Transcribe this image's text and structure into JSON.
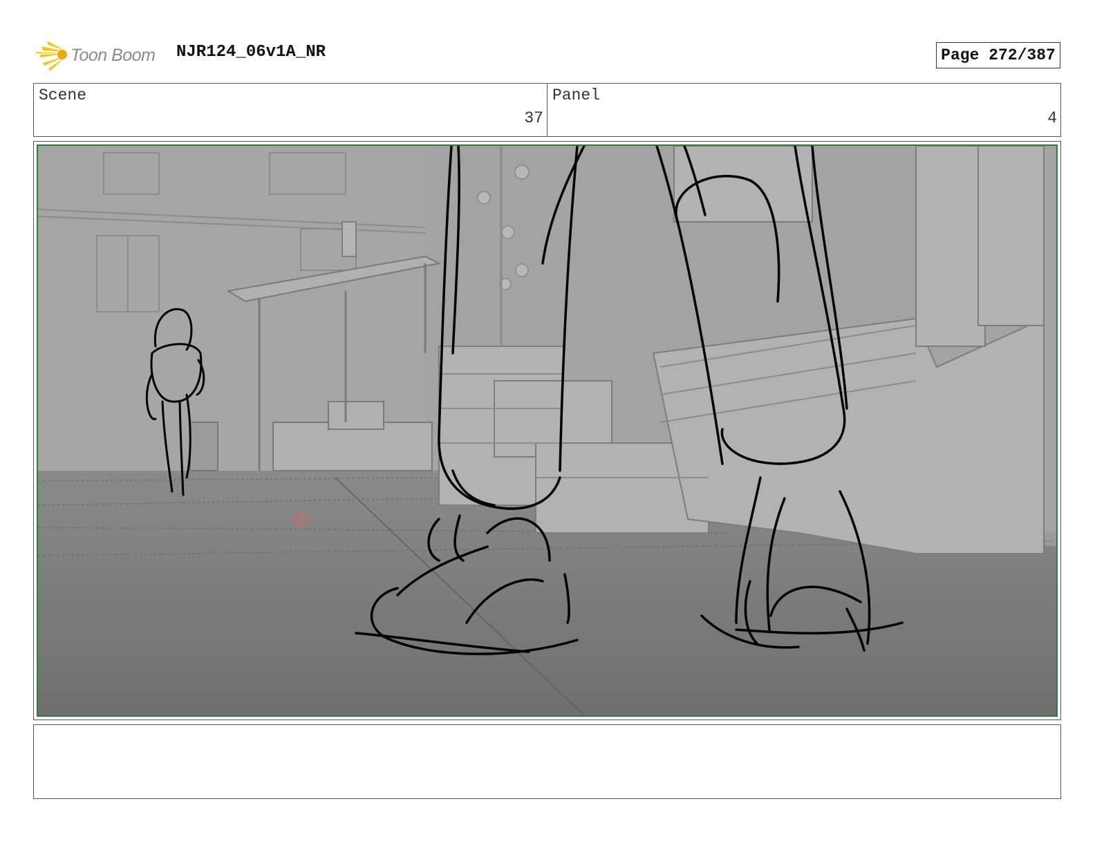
{
  "header": {
    "logo_text": "Toon Boom",
    "title": "NJR124_06v1A_NR",
    "page": "Page 272/387"
  },
  "info": {
    "scene_label": "Scene",
    "scene_value": "37",
    "panel_label": "Panel",
    "panel_value": "4"
  },
  "notes": {
    "text": ""
  },
  "colors": {
    "panel_border": "#2e7d32",
    "logo_accent": "#f5c518"
  }
}
